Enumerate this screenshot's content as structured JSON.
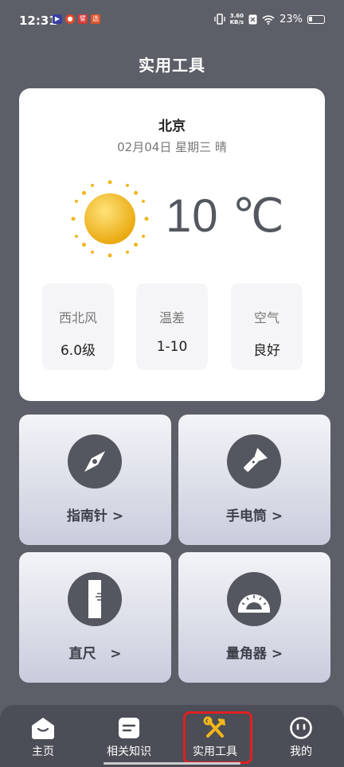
{
  "status_bar": {
    "time": "12:31",
    "network_speed_value": "3.60",
    "network_speed_unit": "KB/s",
    "battery": "23%"
  },
  "header": {
    "title": "实用工具"
  },
  "weather": {
    "city": "北京",
    "date_line": "02月04日 星期三 晴",
    "temperature": "10 ℃",
    "stats": [
      {
        "label": "西北风",
        "value": "6.0级"
      },
      {
        "label": "温差",
        "value": "1-10"
      },
      {
        "label": "空气",
        "value": "良好"
      }
    ]
  },
  "tools": [
    {
      "label": "指南针 >",
      "icon": "compass-icon"
    },
    {
      "label": "手电筒 >",
      "icon": "flashlight-icon"
    },
    {
      "label": "直尺   >",
      "icon": "ruler-icon"
    },
    {
      "label": "量角器 >",
      "icon": "protractor-icon"
    }
  ],
  "nav": {
    "items": [
      {
        "label": "主页",
        "icon": "home-icon"
      },
      {
        "label": "相关知识",
        "icon": "knowledge-icon"
      },
      {
        "label": "实用工具",
        "icon": "tools-icon"
      },
      {
        "label": "我的",
        "icon": "profile-icon"
      }
    ],
    "active_index": 2,
    "highlight_color": "#e02020"
  },
  "colors": {
    "background": "#5c5f67",
    "accent_dark": "#54575f",
    "sun": "#f2b61c"
  }
}
